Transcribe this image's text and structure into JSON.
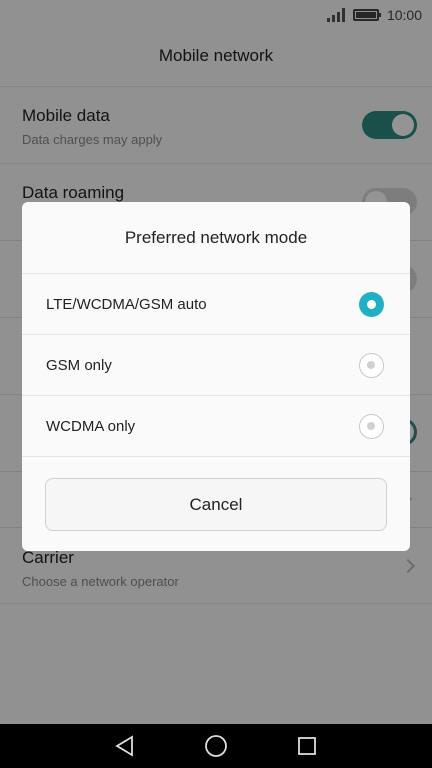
{
  "status_bar": {
    "time": "10:00"
  },
  "screen": {
    "title": "Mobile network",
    "settings": [
      {
        "title": "Mobile data",
        "subtitle": "Data charges may apply",
        "toggle": "on"
      },
      {
        "title": "Data roaming",
        "subtitle": "",
        "toggle": "off"
      },
      {
        "title": "Carrier",
        "subtitle": "Choose a network operator"
      }
    ]
  },
  "dialog": {
    "title": "Preferred network mode",
    "options": [
      {
        "label": "LTE/WCDMA/GSM auto",
        "selected": true
      },
      {
        "label": "GSM only",
        "selected": false
      },
      {
        "label": "WCDMA only",
        "selected": false
      }
    ],
    "cancel_label": "Cancel"
  },
  "colors": {
    "accent": "#21b0c3",
    "toggle_on": "#2e8b80"
  },
  "nav": {
    "icons": [
      "back-icon",
      "home-icon",
      "recents-icon"
    ]
  }
}
